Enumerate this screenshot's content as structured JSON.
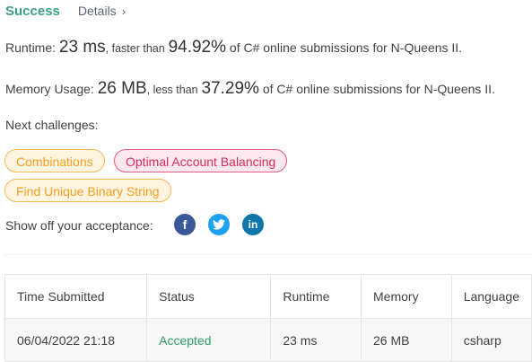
{
  "header": {
    "status": "Success",
    "details_label": "Details",
    "chevron": "›"
  },
  "runtime": {
    "label": "Runtime:",
    "value": "23 ms",
    "mid": ", faster than",
    "percent": "94.92%",
    "tail": "of C# online submissions for N-Queens II."
  },
  "memory": {
    "label": "Memory Usage:",
    "value": "26 MB",
    "mid": ", less than",
    "percent": "37.29%",
    "tail": "of C# online submissions for N-Queens II."
  },
  "next_challenges": {
    "label": "Next challenges:",
    "items": [
      {
        "label": "Combinations",
        "difficulty": "medium"
      },
      {
        "label": "Optimal Account Balancing",
        "difficulty": "hard"
      },
      {
        "label": "Find Unique Binary String",
        "difficulty": "medium"
      }
    ]
  },
  "share": {
    "label": "Show off your acceptance:",
    "icons": [
      {
        "name": "facebook-icon",
        "glyph": "f",
        "color": "#3b5998"
      },
      {
        "name": "twitter-icon",
        "glyph": "t",
        "color": "#1da1f2"
      },
      {
        "name": "linkedin-icon",
        "glyph": "in",
        "color": "#0e76a8"
      }
    ]
  },
  "table": {
    "headers": [
      "Time Submitted",
      "Status",
      "Runtime",
      "Memory",
      "Language"
    ],
    "rows": [
      [
        "06/04/2022 21:18",
        "Accepted",
        "23 ms",
        "26 MB",
        "csharp"
      ]
    ]
  }
}
